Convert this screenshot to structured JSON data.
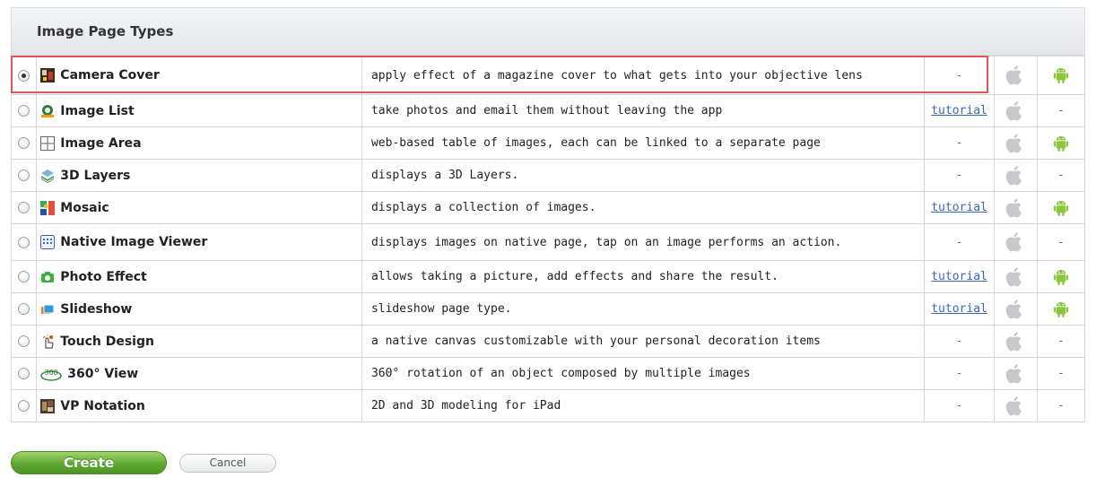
{
  "header": {
    "title": "Image Page Types"
  },
  "rows": [
    {
      "name": "Camera Cover",
      "icon": "camera-cover-icon",
      "description": "apply effect of a magazine cover to what gets into your objective lens",
      "tutorial": "-",
      "ios": true,
      "android": true,
      "selected": true
    },
    {
      "name": "Image List",
      "icon": "image-list-icon",
      "description": "take photos and email them without leaving the app",
      "tutorial": "tutorial",
      "ios": true,
      "android": false,
      "selected": false
    },
    {
      "name": "Image Area",
      "icon": "grid-icon",
      "description": "web-based table of images, each can be linked to a separate page",
      "tutorial": "-",
      "ios": true,
      "android": true,
      "selected": false
    },
    {
      "name": "3D Layers",
      "icon": "layers-icon",
      "description": "displays a 3D Layers.",
      "tutorial": "-",
      "ios": true,
      "android": false,
      "selected": false
    },
    {
      "name": "Mosaic",
      "icon": "mosaic-icon",
      "description": "displays a collection of images.",
      "tutorial": "tutorial",
      "ios": true,
      "android": true,
      "selected": false
    },
    {
      "name": "Native Image Viewer",
      "icon": "image-viewer-icon",
      "description": "displays images on native page, tap on an image performs an action.",
      "tutorial": "-",
      "ios": true,
      "android": false,
      "selected": false
    },
    {
      "name": "Photo Effect",
      "icon": "photo-effect-icon",
      "description": "allows taking a picture, add effects and share the result.",
      "tutorial": "tutorial",
      "ios": true,
      "android": true,
      "selected": false
    },
    {
      "name": "Slideshow",
      "icon": "slideshow-icon",
      "description": "slideshow page type.",
      "tutorial": "tutorial",
      "ios": true,
      "android": true,
      "selected": false
    },
    {
      "name": "Touch Design",
      "icon": "touch-design-icon",
      "description": "a native canvas customizable with your personal decoration items",
      "tutorial": "-",
      "ios": true,
      "android": false,
      "selected": false
    },
    {
      "name": "360° View",
      "icon": "360-view-icon",
      "description": "360° rotation of an object composed by multiple images",
      "tutorial": "-",
      "ios": true,
      "android": false,
      "selected": false
    },
    {
      "name": "VP Notation",
      "icon": "vp-notation-icon",
      "description": "2D and 3D modeling for iPad",
      "tutorial": "-",
      "ios": true,
      "android": false,
      "selected": false
    }
  ],
  "missing_platform_text": "-",
  "buttons": {
    "create": "Create",
    "cancel": "Cancel"
  },
  "colors": {
    "accent_green": "#5ea832",
    "link": "#3a66b8",
    "highlight": "#e4555a"
  }
}
